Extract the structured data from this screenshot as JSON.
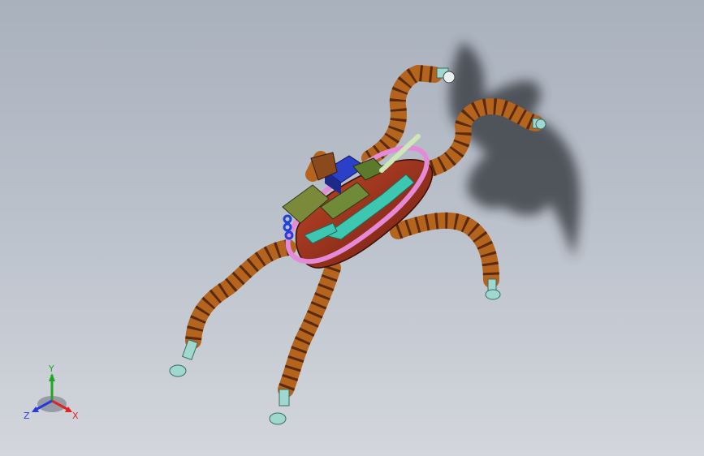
{
  "view": {
    "background_top": "#a9b1bd",
    "background_bottom": "#d3d6dc"
  },
  "model": {
    "body_color": "#a0341e",
    "leg_link_color": "#b5641e",
    "frame_color": "#e58ad8",
    "bracket_color": "#3ec7b0",
    "motor_color": "#2b3fc8",
    "battery_color": "#7a8a3a",
    "foot_color": "#9fd8cf",
    "shadow_color": "#2f3338"
  },
  "triad": {
    "x_label": "X",
    "y_label": "Y",
    "z_label": "Z",
    "x_color": "#e32222",
    "y_color": "#1fa81f",
    "z_color": "#2a3ad8"
  }
}
